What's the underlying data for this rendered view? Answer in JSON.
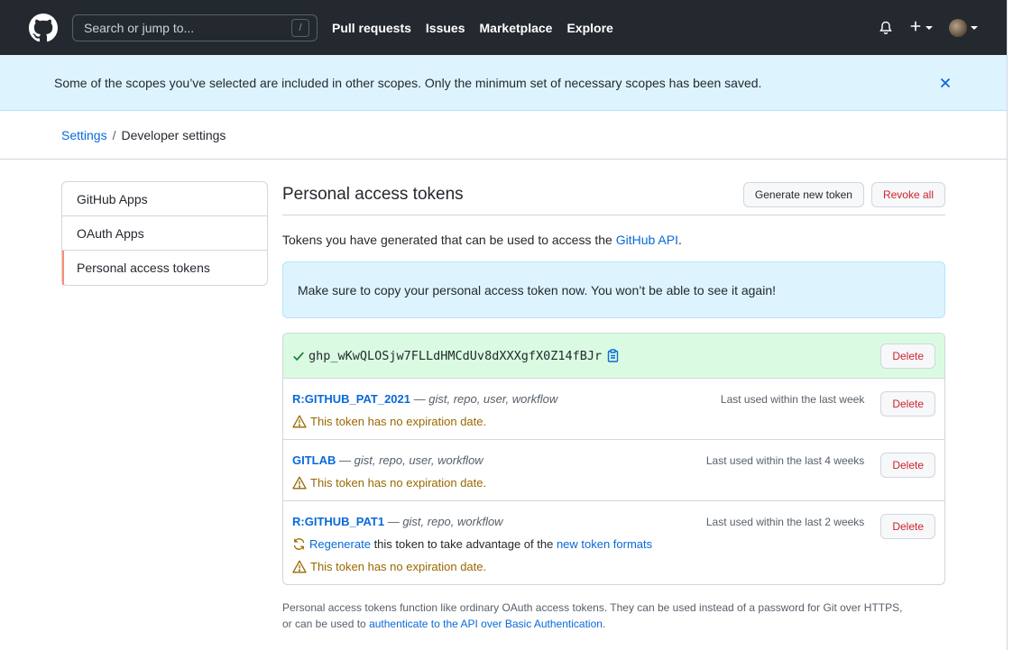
{
  "header": {
    "search_placeholder": "Search or jump to...",
    "search_shortcut": "/",
    "nav": [
      "Pull requests",
      "Issues",
      "Marketplace",
      "Explore"
    ]
  },
  "flash": {
    "message": "Some of the scopes you’ve selected are included in other scopes. Only the minimum set of necessary scopes has been saved."
  },
  "breadcrumb": {
    "parent": "Settings",
    "separator": "/",
    "current": "Developer settings"
  },
  "sidenav": {
    "items": [
      "GitHub Apps",
      "OAuth Apps",
      "Personal access tokens"
    ]
  },
  "content": {
    "title": "Personal access tokens",
    "generate_label": "Generate new token",
    "revoke_label": "Revoke all",
    "desc_prefix": "Tokens you have generated that can be used to access the ",
    "desc_link": "GitHub API",
    "desc_suffix": ".",
    "notice": "Make sure to copy your personal access token now. You won’t be able to see it again!",
    "new_token": "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",
    "delete_label": "Delete",
    "tokens": [
      {
        "name": "R:GITHUB_PAT_2021",
        "dash": " — ",
        "scopes": "gist, repo, user, workflow",
        "last_used": "Last used within the last week",
        "warning": "This token has no expiration date."
      },
      {
        "name": "GITLAB",
        "dash": " — ",
        "scopes": "gist, repo, user, workflow",
        "last_used": "Last used within the last 4 weeks",
        "warning": "This token has no expiration date."
      },
      {
        "name": "R:GITHUB_PAT1",
        "dash": " — ",
        "scopes": "gist, repo, workflow",
        "last_used": "Last used within the last 2 weeks",
        "regen_link": "Regenerate",
        "regen_middle": " this token to take advantage of the ",
        "regen_link2": "new token formats",
        "warning": "This token has no expiration date."
      }
    ],
    "footnote_line1": "Personal access tokens function like ordinary OAuth access tokens. They can be used instead of a password for Git over HTTPS,",
    "footnote_prefix": "or can be used to ",
    "footnote_link": "authenticate to the API over Basic Authentication",
    "footnote_suffix": "."
  },
  "colors": {
    "header_bg": "#24292f",
    "link": "#0969da",
    "danger": "#cf222e",
    "warning": "#9a6700",
    "success": "#1a7f37",
    "flash_bg": "#ddf4ff",
    "new_token_bg": "#dafbe1"
  }
}
